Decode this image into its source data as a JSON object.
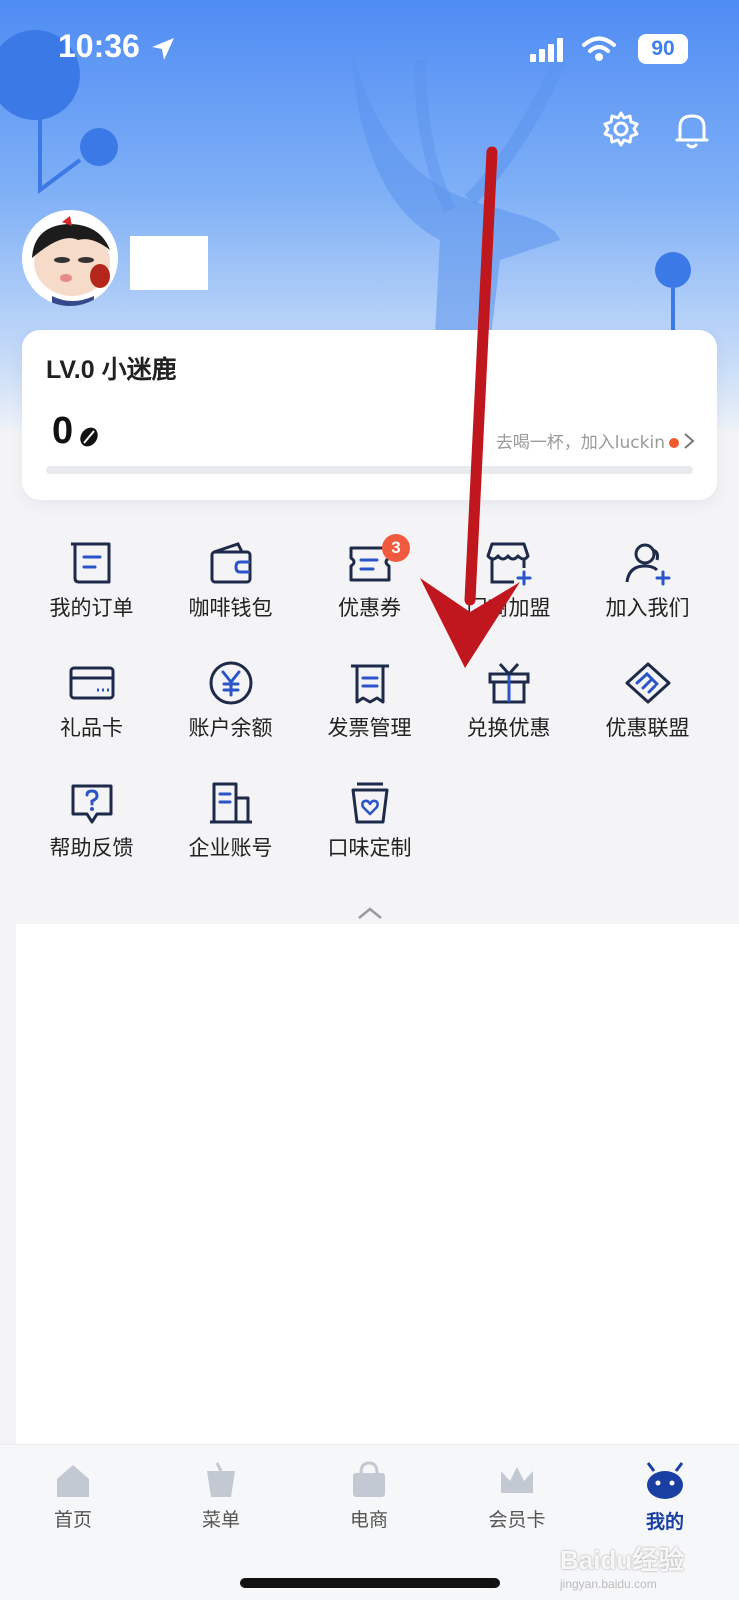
{
  "status_bar": {
    "time": "10:36",
    "battery": "90"
  },
  "level_card": {
    "level": "LV.0 小迷鹿",
    "points": "0",
    "join_text": "去喝一杯，加入luckin"
  },
  "services": [
    {
      "label": "我的订单",
      "icon": "order-icon"
    },
    {
      "label": "咖啡钱包",
      "icon": "wallet-icon"
    },
    {
      "label": "优惠券",
      "icon": "coupon-icon",
      "badge": "3"
    },
    {
      "label": "门商加盟",
      "icon": "store-join-icon"
    },
    {
      "label": "加入我们",
      "icon": "add-user-icon"
    },
    {
      "label": "礼品卡",
      "icon": "gift-card-icon"
    },
    {
      "label": "账户余额",
      "icon": "yuan-icon"
    },
    {
      "label": "发票管理",
      "icon": "invoice-icon"
    },
    {
      "label": "兑换优惠",
      "icon": "gift-icon"
    },
    {
      "label": "优惠联盟",
      "icon": "handshake-icon"
    },
    {
      "label": "帮助反馈",
      "icon": "help-icon"
    },
    {
      "label": "企业账号",
      "icon": "building-icon"
    },
    {
      "label": "口味定制",
      "icon": "cup-heart-icon"
    }
  ],
  "tabs": [
    {
      "label": "首页",
      "icon": "home-icon"
    },
    {
      "label": "菜单",
      "icon": "cup-icon"
    },
    {
      "label": "电商",
      "icon": "bag-icon"
    },
    {
      "label": "会员卡",
      "icon": "crown-icon"
    },
    {
      "label": "我的",
      "icon": "deer-icon",
      "active": true
    }
  ],
  "watermark": {
    "brand": "Baidu经验",
    "url": "jingyan.baidu.com"
  },
  "colors": {
    "accent": "#1a3fa3",
    "header": "#4f8cf4",
    "badge": "#f25a3f",
    "arrow": "#c0161d"
  }
}
